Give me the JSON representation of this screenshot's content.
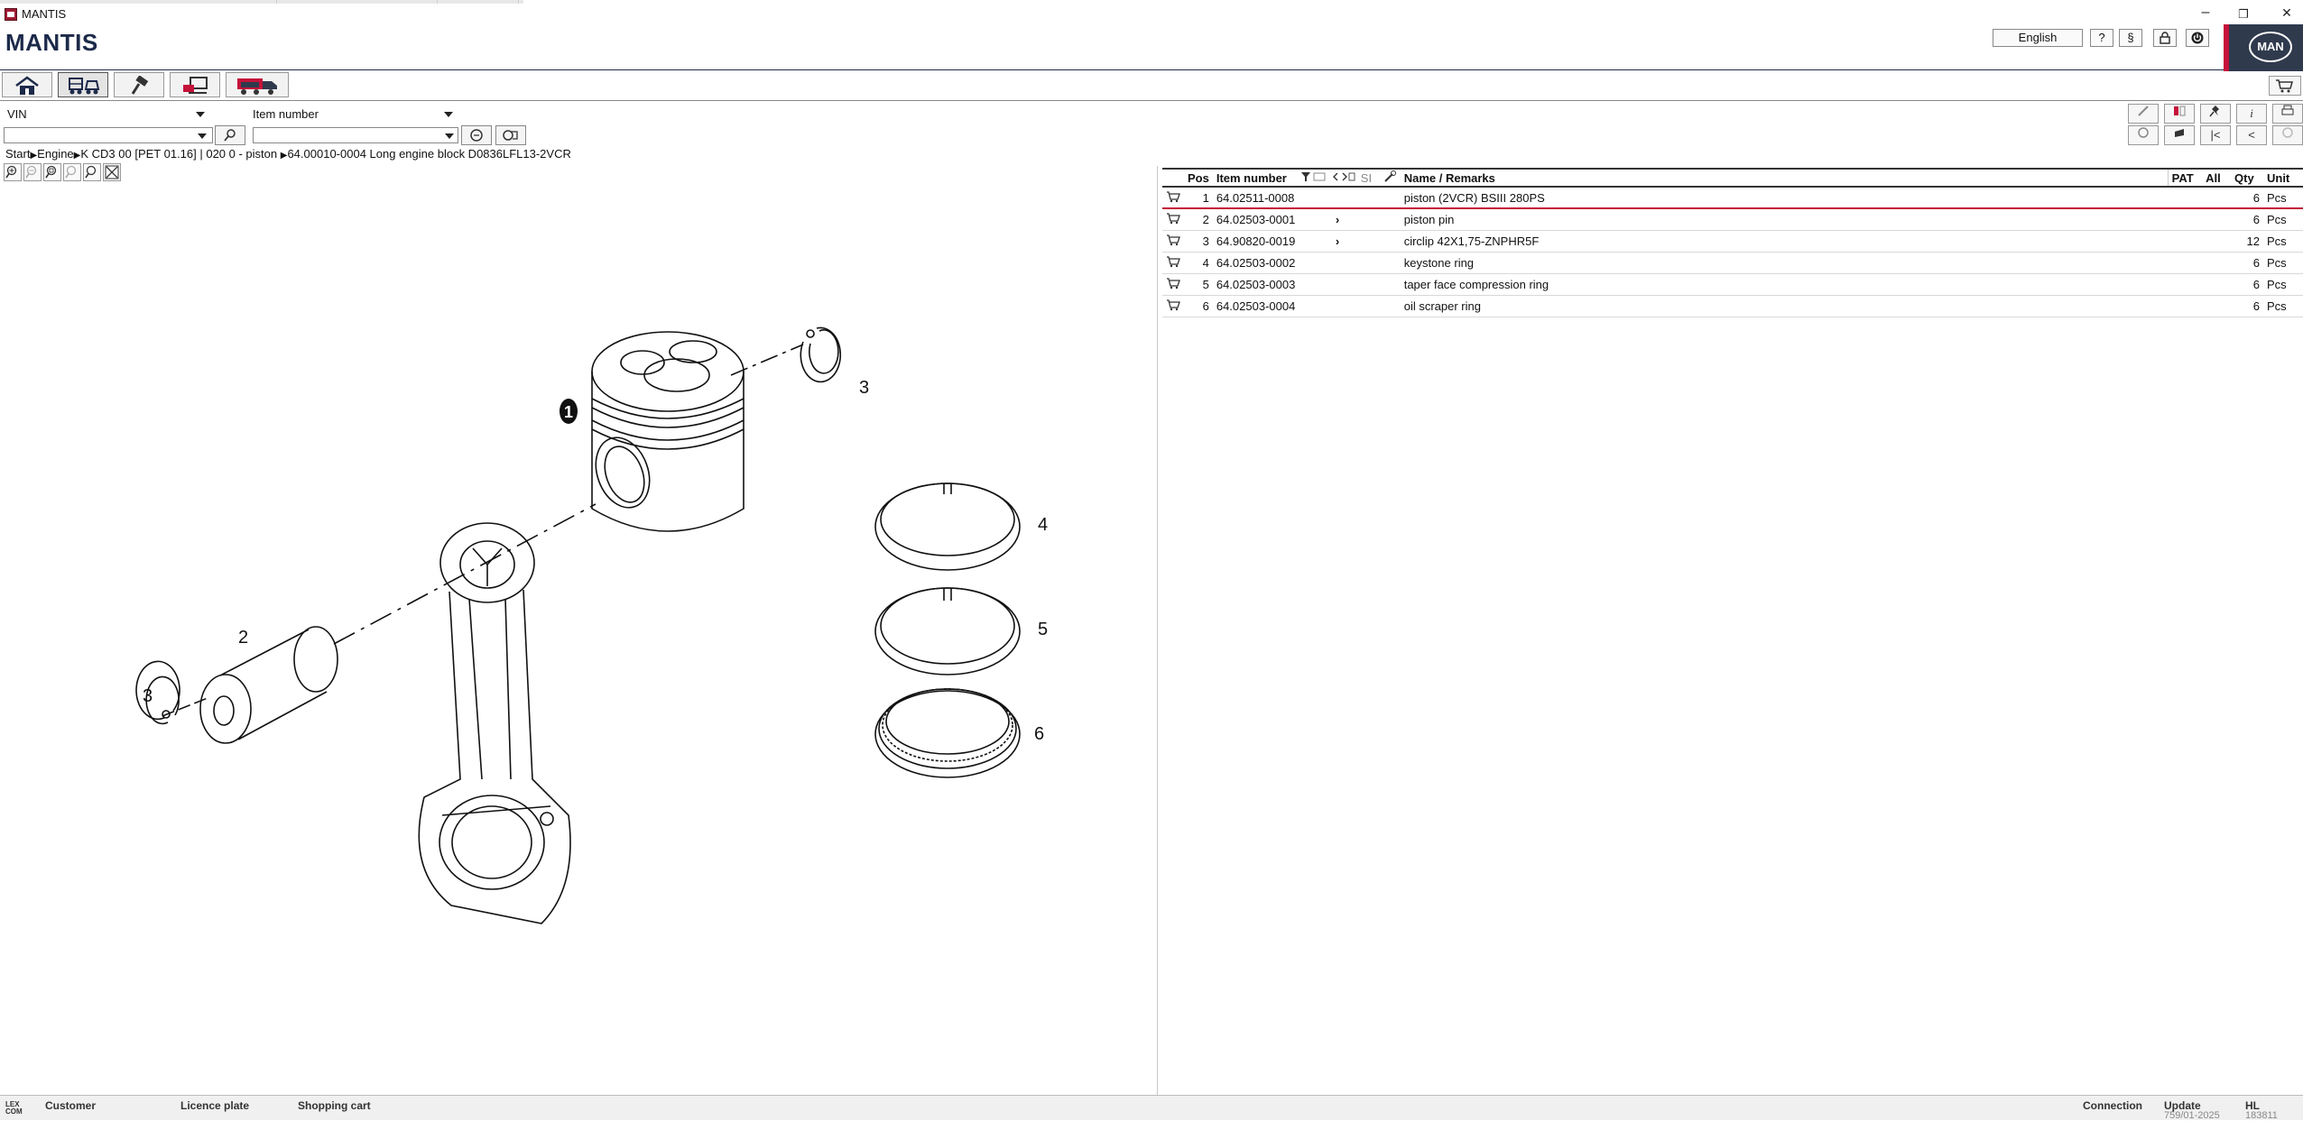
{
  "window": {
    "title": "MANTIS",
    "min": "–",
    "restore": "❐",
    "close": "✕"
  },
  "header": {
    "brand": "MANTIS",
    "language": "English",
    "help": "?",
    "legal": "§",
    "lock": "lock-icon",
    "power": "power-icon",
    "logo_text": "MAN"
  },
  "tabs": [
    {
      "name": "home",
      "icon": "home-icon"
    },
    {
      "name": "vehicle",
      "icon": "vehicles-icon"
    },
    {
      "name": "tools",
      "icon": "hammer-icon"
    },
    {
      "name": "workshop",
      "icon": "computer-icon"
    },
    {
      "name": "truck",
      "icon": "truck-icon"
    }
  ],
  "search": {
    "vin_label": "VIN",
    "vin_value": "",
    "item_label": "Item number",
    "item_value": ""
  },
  "breadcrumb": {
    "p1": "Start",
    "p2": "Engine",
    "p3": "K CD3 00  [PET 01.16]  | 020 0 - piston",
    "p4": "64.00010-0004  Long engine block D0836LFL13-2VCR"
  },
  "toolbar_right": {
    "row1": [
      "edit-icon",
      "compare-icon",
      "pin-icon",
      "i",
      "print-icon"
    ],
    "row2": [
      "view-icon",
      "hand-icon",
      "|<",
      "<",
      "history-icon"
    ]
  },
  "diagram": {
    "callouts": [
      "1",
      "2",
      "3",
      "3",
      "4",
      "5",
      "6"
    ]
  },
  "table": {
    "headers": {
      "pos": "Pos",
      "item": "Item number",
      "si": "SI",
      "name": "Name / Remarks",
      "pat": "PAT",
      "all": "All",
      "qty": "Qty",
      "unit": "Unit"
    },
    "rows": [
      {
        "pos": "1",
        "item": "64.02511-0008",
        "flag": "",
        "name": "piston  (2VCR) BSIII 280PS",
        "qty": "6",
        "unit": "Pcs"
      },
      {
        "pos": "2",
        "item": "64.02503-0001",
        "flag": "›",
        "name": "piston pin",
        "qty": "6",
        "unit": "Pcs"
      },
      {
        "pos": "3",
        "item": "64.90820-0019",
        "flag": "›",
        "name": "circlip  42X1,75-ZNPHR5F",
        "qty": "12",
        "unit": "Pcs"
      },
      {
        "pos": "4",
        "item": "64.02503-0002",
        "flag": "",
        "name": "keystone ring",
        "qty": "6",
        "unit": "Pcs"
      },
      {
        "pos": "5",
        "item": "64.02503-0003",
        "flag": "",
        "name": "taper face compression ring",
        "qty": "6",
        "unit": "Pcs"
      },
      {
        "pos": "6",
        "item": "64.02503-0004",
        "flag": "",
        "name": "oil scraper ring",
        "qty": "6",
        "unit": "Pcs"
      }
    ]
  },
  "status": {
    "customer": "Customer",
    "licence": "Licence plate",
    "cart": "Shopping cart",
    "connection": "Connection",
    "update": "Update",
    "update_val": "759/01-2025",
    "hl": "HL",
    "hl_val": "183811",
    "lexcom": "LEX COM"
  },
  "colors": {
    "brand": "#1d2a4a",
    "accent": "#c4123a",
    "logo_bg": "#2f3a4d"
  }
}
